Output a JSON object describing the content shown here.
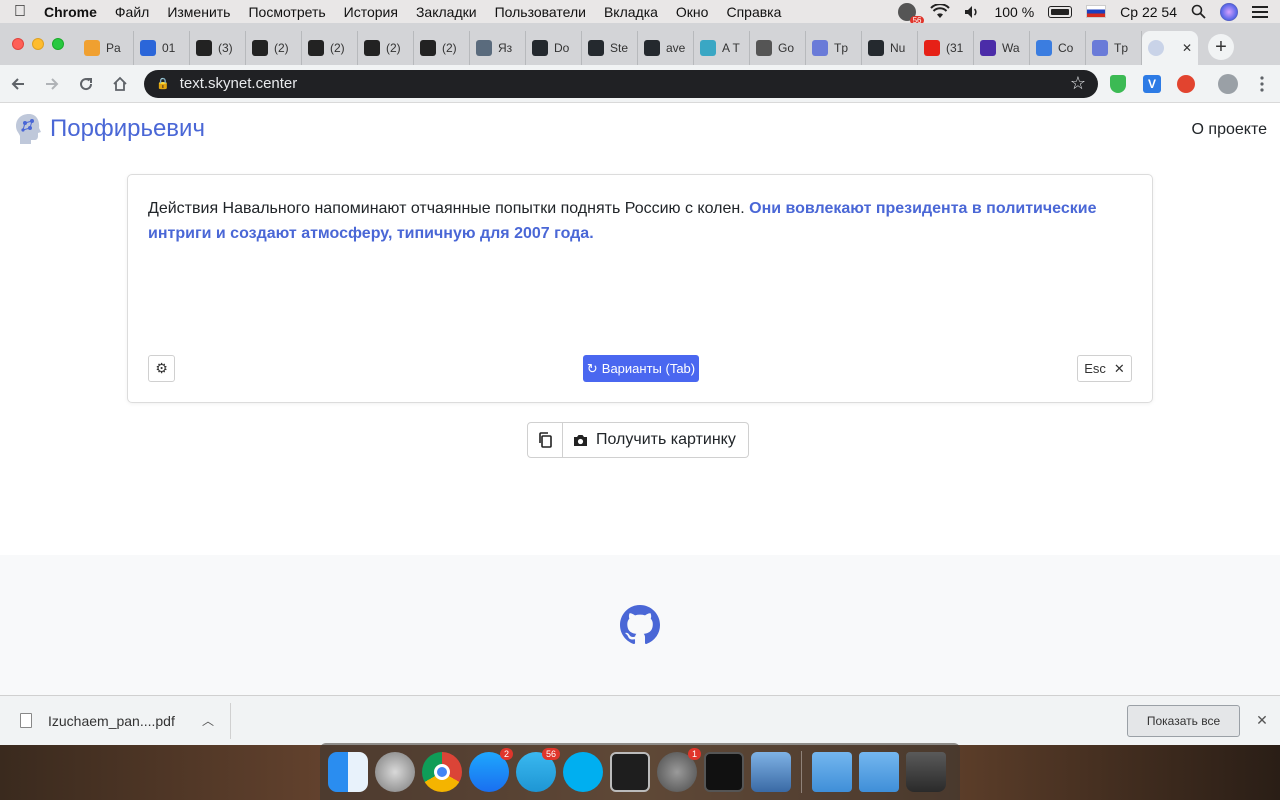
{
  "menubar": {
    "app": "Chrome",
    "items": [
      "Файл",
      "Изменить",
      "Посмотреть",
      "История",
      "Закладки",
      "Пользователи",
      "Вкладка",
      "Окно",
      "Справка"
    ],
    "notification_count": "56",
    "battery": "100 %",
    "clock": "Ср 22 54"
  },
  "tabs": [
    {
      "label": "Pa",
      "color": "#f0a030"
    },
    {
      "label": "01",
      "color": "#2b66d9"
    },
    {
      "label": "(3)",
      "color": "#222222"
    },
    {
      "label": "(2)",
      "color": "#222222"
    },
    {
      "label": "(2)",
      "color": "#222222"
    },
    {
      "label": "(2)",
      "color": "#222222"
    },
    {
      "label": "(2)",
      "color": "#222222"
    },
    {
      "label": "Яз",
      "color": "#5a6b7d"
    },
    {
      "label": "Do",
      "color": "#24292e"
    },
    {
      "label": "Ste",
      "color": "#24292e"
    },
    {
      "label": "ave",
      "color": "#24292e"
    },
    {
      "label": "A T",
      "color": "#3aa7c4"
    },
    {
      "label": "Go",
      "color": "#555555"
    },
    {
      "label": "Tp",
      "color": "#6a7bd8"
    },
    {
      "label": "Nu",
      "color": "#24292e"
    },
    {
      "label": "(31",
      "color": "#e62117"
    },
    {
      "label": "Wa",
      "color": "#4b2ca8"
    },
    {
      "label": "Co",
      "color": "#3b7de0"
    },
    {
      "label": "Tp",
      "color": "#6a7bd8"
    }
  ],
  "address": {
    "url": "text.skynet.center"
  },
  "site": {
    "brand": "Порфирьевич",
    "about": "О проекте"
  },
  "editor": {
    "prompt": "Действия Навального напоминают отчаянные попытки поднять Россию с колен.",
    "generated": "Они вовлекают президента в политические интриги и создают атмосферу, типичную для 2007 года."
  },
  "controls": {
    "variants": "Варианты (Tab)",
    "esc": "Esc",
    "get_picture": "Получить картинку"
  },
  "downloads": {
    "file": "Izuchaem_pan....pdf",
    "show_all": "Показать все"
  },
  "dock": {
    "badges": {
      "appstore": "2",
      "telegram": "56",
      "settings": "1"
    }
  }
}
